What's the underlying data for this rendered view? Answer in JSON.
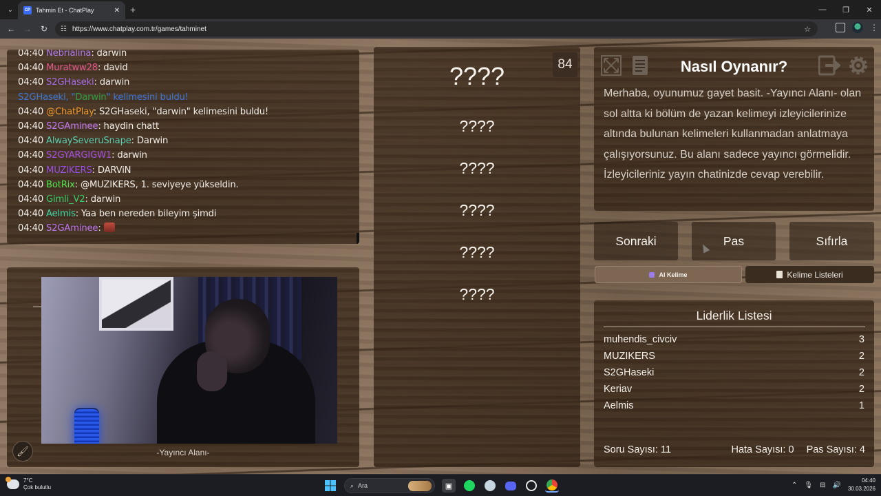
{
  "browser": {
    "tab_title": "Tahmin Et - ChatPlay",
    "tab_favicon": "CP",
    "url": "https://www.chatplay.com.tr/games/tahminet"
  },
  "chat": {
    "messages": [
      {
        "time": "04:40",
        "user": "Nebrialina",
        "color": "#b07cf0",
        "text": ": darwin"
      },
      {
        "time": "04:40",
        "user": "Muratww28",
        "color": "#e0568b",
        "text": ": david"
      },
      {
        "time": "04:40",
        "user": "S2GHaseki",
        "color": "#a96ce8",
        "text": ": darwin"
      },
      {
        "time": "04:40",
        "user": "@ChatPlay",
        "color": "#f09a2a",
        "text": ": S2GHaseki, \"darwin\" kelimesini buldu!"
      },
      {
        "time": "04:40",
        "user": "S2GAminee",
        "color": "#c077ef",
        "text": ": haydin chatt"
      },
      {
        "time": "04:40",
        "user": "AlwaySeveruSnape",
        "color": "#5bd0b0",
        "text": ": Darwin"
      },
      {
        "time": "04:40",
        "user": "S2GYARGIGW1",
        "color": "#a64fe0",
        "text": ": darwin"
      },
      {
        "time": "04:40",
        "user": "MUZIKERS",
        "color": "#9b50e6",
        "text": ": DARViN"
      },
      {
        "time": "04:40",
        "user": "BotRix",
        "color": "#4de24d",
        "text": ": @MUZIKERS, 1. seviyeye yükseldin."
      },
      {
        "time": "04:40",
        "user": "Gimli_V2",
        "color": "#3bcf6a",
        "text": ": darwin"
      },
      {
        "time": "04:40",
        "user": "Aelmis",
        "color": "#3bd7a4",
        "text": ": Yaa ben nereden bileyim şimdi"
      },
      {
        "time": "04:40",
        "user": "S2GAminee",
        "color": "#c077ef",
        "text": ": "
      }
    ],
    "system_line": {
      "part1": "S2GHaseki, \"",
      "word": "Darwin",
      "part2": "\" kelimesini buldu!"
    }
  },
  "streamer": {
    "caption": "-Yayıncı Alanı-"
  },
  "words": {
    "counter": "84",
    "slots": [
      "????",
      "????",
      "????",
      "????",
      "????",
      "????"
    ]
  },
  "howto": {
    "title": "Nasıl Oynanır?",
    "text": "Merhaba, oyunumuz gayet basit. -Yayıncı Alanı- olan sol altta ki bölüm de yazan kelimeyi izleyicilerinize altında bulunan kelimeleri kullanmadan anlatmaya çalışıyorsunuz. Bu alanı sadece yayıncı görmelidir. İzleyicileriniz yayın chatinizde cevap verebilir."
  },
  "controls": {
    "next": "Sonraki",
    "pass": "Pas",
    "reset": "Sıfırla",
    "ai_word": "AI Kelime",
    "word_lists": "Kelime Listeleri"
  },
  "leaderboard": {
    "title": "Liderlik Listesi",
    "rows": [
      {
        "name": "muhendis_civciv",
        "score": "3"
      },
      {
        "name": "MUZIKERS",
        "score": "2"
      },
      {
        "name": "S2GHaseki",
        "score": "2"
      },
      {
        "name": "Keriav",
        "score": "2"
      },
      {
        "name": "Aelmis",
        "score": "1"
      }
    ],
    "question_count": "Soru Sayısı: 11",
    "error_count": "Hata Sayısı: 0",
    "pass_count": "Pas Sayısı: 4"
  },
  "taskbar": {
    "temperature": "7°C",
    "weather": "Çok bulutlu",
    "search": "Ara",
    "time": "04:40",
    "date": "30.03.2026"
  }
}
